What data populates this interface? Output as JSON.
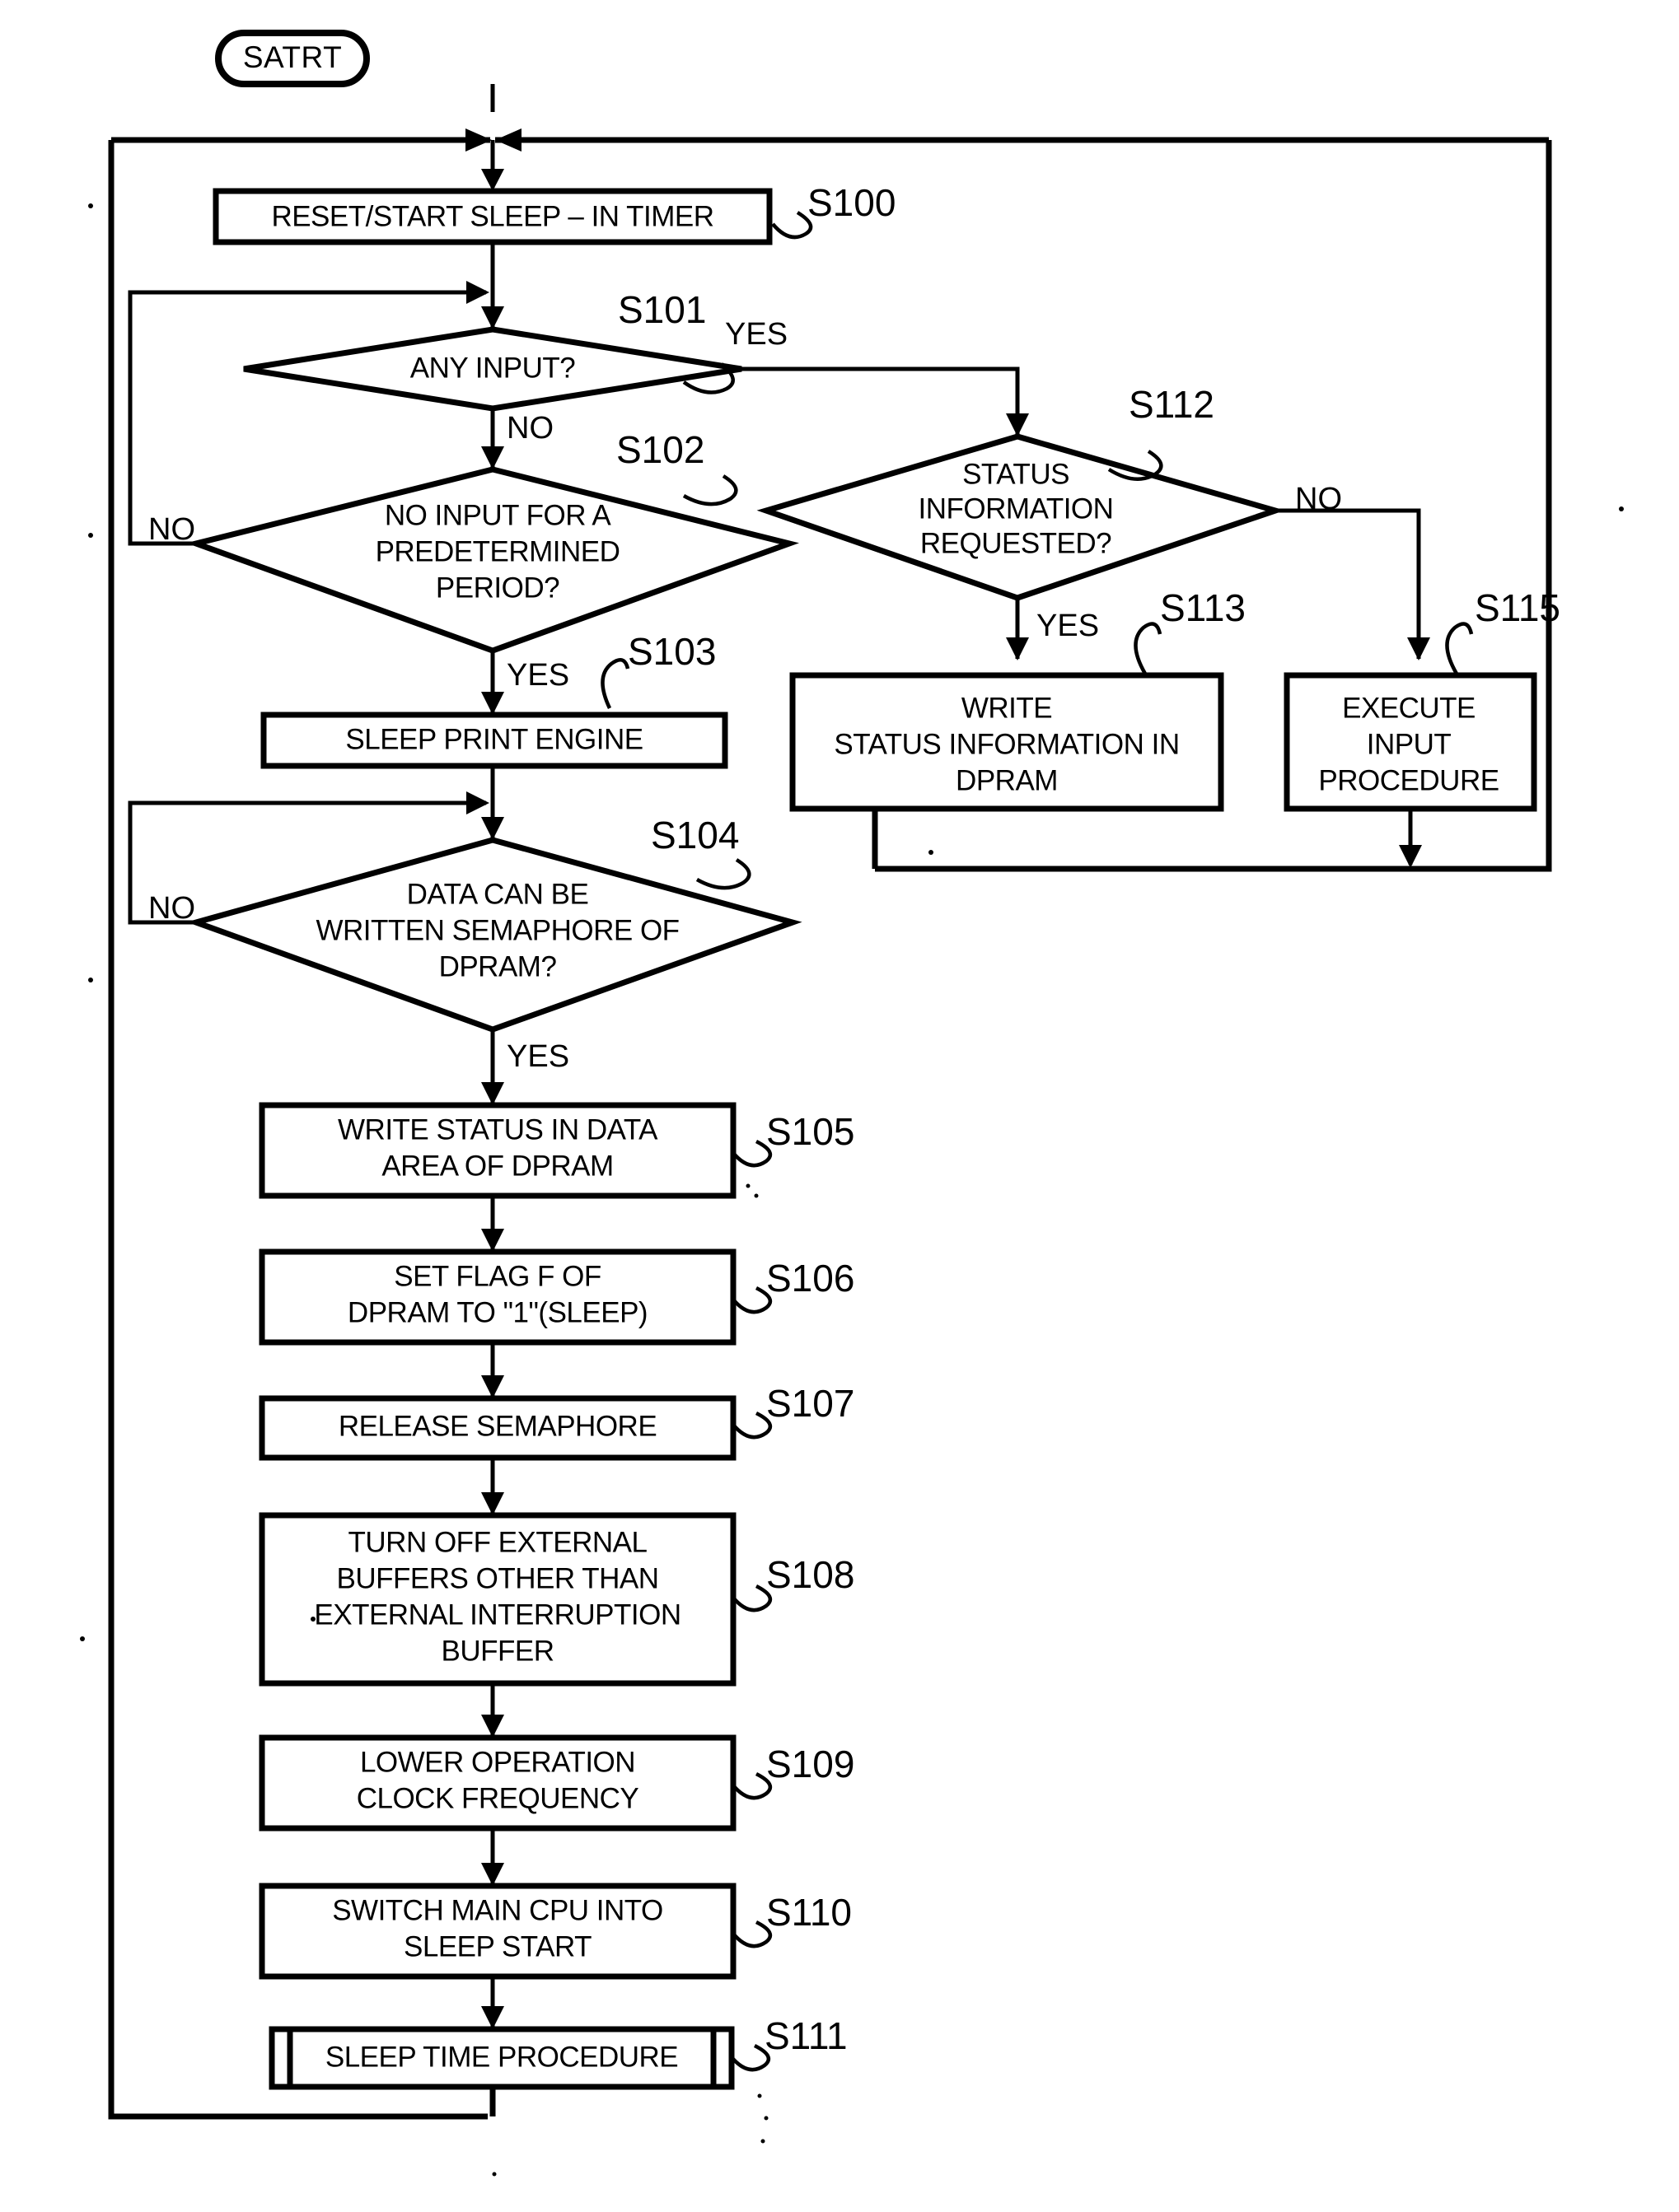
{
  "figure": {
    "type": "flowchart",
    "title": "",
    "start_node": {
      "id": "start",
      "label": "SATRT",
      "shape": "terminator"
    },
    "nodes": [
      {
        "id": "S100",
        "step": "S100",
        "shape": "process",
        "lines": [
          "RESET/START SLEEP – IN TIMER"
        ]
      },
      {
        "id": "S101",
        "step": "S101",
        "shape": "decision",
        "lines": [
          "ANY INPUT?"
        ],
        "yes_label": "YES",
        "no_label": "NO"
      },
      {
        "id": "S102",
        "step": "S102",
        "shape": "decision",
        "lines": [
          "NO INPUT FOR A",
          "PREDETERMINED",
          "PERIOD?"
        ],
        "yes_label": "YES",
        "no_label": "NO"
      },
      {
        "id": "S103",
        "step": "S103",
        "shape": "process",
        "lines": [
          "SLEEP PRINT ENGINE"
        ]
      },
      {
        "id": "S104",
        "step": "S104",
        "shape": "decision",
        "lines": [
          "DATA CAN BE",
          "WRITTEN SEMAPHORE OF",
          "DPRAM?"
        ],
        "yes_label": "YES",
        "no_label": "NO"
      },
      {
        "id": "S105",
        "step": "S105",
        "shape": "process",
        "lines": [
          "WRITE STATUS IN DATA",
          "AREA OF DPRAM"
        ]
      },
      {
        "id": "S106",
        "step": "S106",
        "shape": "process",
        "lines": [
          "SET FLAG F OF",
          "DPRAM TO \"1\"(SLEEP)"
        ]
      },
      {
        "id": "S107",
        "step": "S107",
        "shape": "process",
        "lines": [
          "RELEASE SEMAPHORE"
        ]
      },
      {
        "id": "S108",
        "step": "S108",
        "shape": "process",
        "lines": [
          "TURN OFF EXTERNAL",
          "BUFFERS OTHER THAN",
          "EXTERNAL INTERRUPTION",
          "BUFFER"
        ]
      },
      {
        "id": "S109",
        "step": "S109",
        "shape": "process",
        "lines": [
          "LOWER OPERATION",
          "CLOCK FREQUENCY"
        ]
      },
      {
        "id": "S110",
        "step": "S110",
        "shape": "process",
        "lines": [
          "SWITCH MAIN CPU INTO",
          "SLEEP START"
        ]
      },
      {
        "id": "S111",
        "step": "S111",
        "shape": "predefined-process",
        "lines": [
          "SLEEP TIME PROCEDURE"
        ]
      },
      {
        "id": "S112",
        "step": "S112",
        "shape": "decision",
        "lines": [
          "STATUS",
          "INFORMATION",
          "REQUESTED?"
        ],
        "yes_label": "YES",
        "no_label": "NO"
      },
      {
        "id": "S113",
        "step": "S113",
        "shape": "process",
        "lines": [
          "WRITE",
          "STATUS INFORMATION IN",
          "DPRAM"
        ]
      },
      {
        "id": "S115",
        "step": "S115",
        "shape": "process",
        "lines": [
          "EXECUTE",
          "INPUT",
          "PROCEDURE"
        ]
      }
    ],
    "edges": [
      {
        "from": "start",
        "to": "S100",
        "label": ""
      },
      {
        "from": "S100",
        "to": "S101",
        "label": ""
      },
      {
        "from": "S101",
        "to": "S102",
        "label": "NO"
      },
      {
        "from": "S101",
        "to": "S112",
        "label": "YES"
      },
      {
        "from": "S102",
        "to": "S103",
        "label": "YES"
      },
      {
        "from": "S102",
        "to": "S101",
        "label": "NO"
      },
      {
        "from": "S103",
        "to": "S104",
        "label": ""
      },
      {
        "from": "S104",
        "to": "S105",
        "label": "YES"
      },
      {
        "from": "S104",
        "to": "S104",
        "label": "NO"
      },
      {
        "from": "S105",
        "to": "S106",
        "label": ""
      },
      {
        "from": "S106",
        "to": "S107",
        "label": ""
      },
      {
        "from": "S107",
        "to": "S108",
        "label": ""
      },
      {
        "from": "S108",
        "to": "S109",
        "label": ""
      },
      {
        "from": "S109",
        "to": "S110",
        "label": ""
      },
      {
        "from": "S110",
        "to": "S111",
        "label": ""
      },
      {
        "from": "S111",
        "to": "start",
        "label": ""
      },
      {
        "from": "S112",
        "to": "S113",
        "label": "YES"
      },
      {
        "from": "S112",
        "to": "S115",
        "label": "NO"
      },
      {
        "from": "S113",
        "to": "start",
        "label": ""
      },
      {
        "from": "S115",
        "to": "start",
        "label": ""
      }
    ],
    "colors": {
      "line": "#000000",
      "fill": "#ffffff",
      "text": "#000000"
    }
  }
}
